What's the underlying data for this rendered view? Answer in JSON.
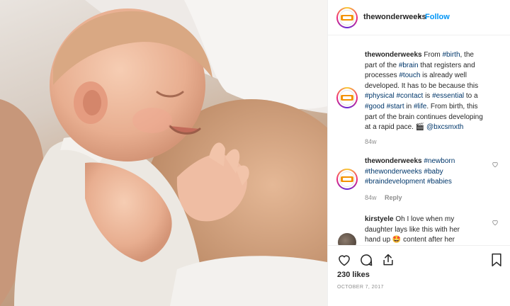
{
  "post": {
    "username": "thewonderweeks",
    "separator": "•",
    "follow_label": "Follow"
  },
  "caption": {
    "username": "thewonderweeks",
    "lines": [
      [
        {
          "t": "From "
        },
        {
          "h": "#birth"
        },
        {
          "t": ", the"
        }
      ],
      [
        {
          "t": "part of the "
        },
        {
          "h": "#brain"
        },
        {
          "t": " that registers and"
        }
      ],
      [
        {
          "t": "processes "
        },
        {
          "h": "#touch"
        },
        {
          "t": " is already well"
        }
      ],
      [
        {
          "t": "developed. It has to be because this"
        }
      ],
      [
        {
          "h": "#physical"
        },
        {
          "t": " "
        },
        {
          "h": "#contact"
        },
        {
          "t": " is "
        },
        {
          "h": "#essential"
        },
        {
          "t": " to a"
        }
      ],
      [
        {
          "h": "#good"
        },
        {
          "t": " "
        },
        {
          "h": "#start"
        },
        {
          "t": " in "
        },
        {
          "h": "#life"
        },
        {
          "t": ". From birth, this"
        }
      ],
      [
        {
          "t": "part of the brain continues developing"
        }
      ],
      [
        {
          "t": "at a rapid pace. 🎬 "
        },
        {
          "h": "@bxcsmxth"
        }
      ]
    ],
    "time": "84w"
  },
  "comment1": {
    "username": "thewonderweeks",
    "lines": [
      [
        {
          "h": "#newborn"
        }
      ],
      [
        {
          "h": "#thewonderweeks"
        },
        {
          "t": " "
        },
        {
          "h": "#baby"
        }
      ],
      [
        {
          "h": "#braindevelopment"
        },
        {
          "t": " "
        },
        {
          "h": "#babies"
        }
      ]
    ],
    "time": "84w",
    "reply_label": "Reply"
  },
  "comment2": {
    "username": "kirstyele",
    "lines": [
      [
        {
          "t": "Oh I love when my"
        }
      ],
      [
        {
          "t": "daughter lays like this with her"
        }
      ],
      [
        {
          "t": "hand up 🤩 content after her"
        }
      ]
    ]
  },
  "likes": "230 likes",
  "date": "OCTOBER 7, 2017",
  "icons": {
    "like": "heart-icon",
    "comment": "comment-icon",
    "share": "share-icon",
    "save": "bookmark-icon"
  },
  "colors": {
    "follow": "#0095f6",
    "hashtag": "#00376b",
    "meta": "#8e8e8e",
    "avatar_ring": "#ee2a7b",
    "logo_orange": "#f39200"
  }
}
